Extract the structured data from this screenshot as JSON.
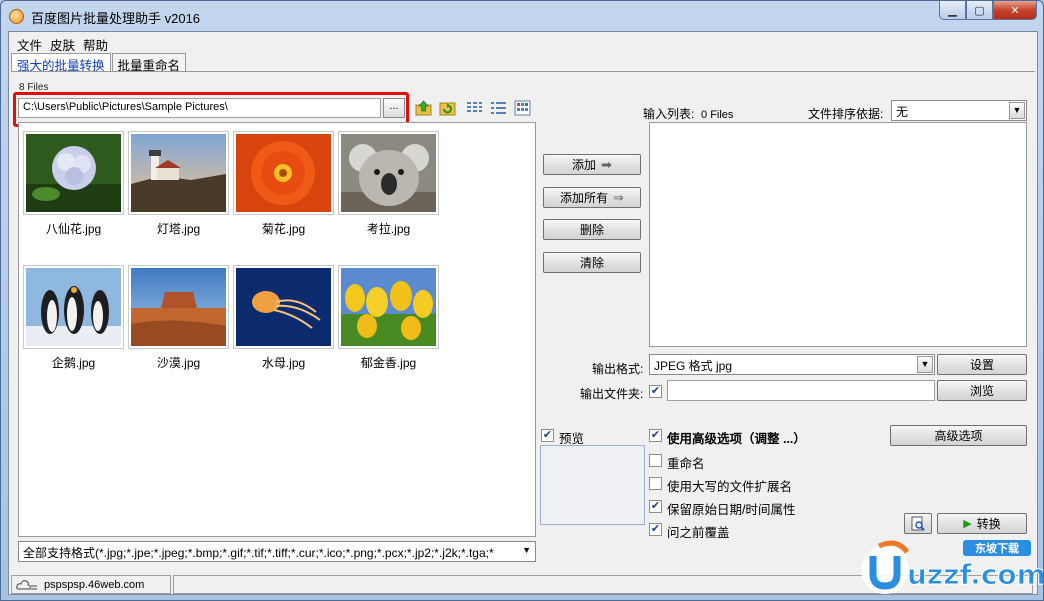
{
  "window": {
    "title": "百度图片批量处理助手  v2016",
    "minimize_icon": "minimize-icon",
    "maximize_icon": "maximize-icon",
    "close_icon": "close-icon"
  },
  "menu": [
    "文件",
    "皮肤",
    "帮助"
  ],
  "tabs": [
    {
      "label": "强大的批量转换",
      "active": true
    },
    {
      "label": "批量重命名",
      "active": false
    }
  ],
  "left": {
    "file_count": "8 Files",
    "path": "C:\\Users\\Public\\Pictures\\Sample Pictures\\",
    "browse_label": "...",
    "toolbar_icons": [
      "folder-up-icon",
      "refresh-icon",
      "list-view-icon",
      "detail-view-icon",
      "thumbnail-view-icon"
    ],
    "thumbnails": [
      {
        "name": "八仙花.jpg",
        "icon": "hydrangea-photo"
      },
      {
        "name": "灯塔.jpg",
        "icon": "lighthouse-photo"
      },
      {
        "name": "菊花.jpg",
        "icon": "chrysanthemum-photo"
      },
      {
        "name": "考拉.jpg",
        "icon": "koala-photo"
      },
      {
        "name": "企鹅.jpg",
        "icon": "penguins-photo"
      },
      {
        "name": "沙漠.jpg",
        "icon": "desert-photo"
      },
      {
        "name": "水母.jpg",
        "icon": "jellyfish-photo"
      },
      {
        "name": "郁金香.jpg",
        "icon": "tulips-photo"
      }
    ],
    "filter": "全部支持格式(*.jpg;*.jpe;*.jpeg;*.bmp;*.gif;*.tif;*.tiff;*.cur;*.ico;*.png;*.pcx;*.jp2;*.j2k;*.tga;*"
  },
  "middle": {
    "add": "添加",
    "add_all": "添加所有",
    "delete": "删除",
    "clear": "清除"
  },
  "right": {
    "input_list_label": "输入列表:",
    "input_list_count": "0 Files",
    "sort_label": "文件排序依据:",
    "sort_value": "无",
    "output_format_label": "输出格式:",
    "output_format_value": "JPEG 格式 jpg",
    "settings": "设置",
    "output_folder_label": "输出文件夹:",
    "output_folder_checked": true,
    "output_folder_value": "",
    "browse": "浏览",
    "preview_label": "预览",
    "preview_checked": true,
    "options": [
      {
        "label": "使用高级选项（调整 ...）",
        "checked": true,
        "bold": true
      },
      {
        "label": "重命名",
        "checked": false
      },
      {
        "label": "使用大写的文件扩展名",
        "checked": false
      },
      {
        "label": "保留原始日期/时间属性",
        "checked": true
      },
      {
        "label": "问之前覆盖",
        "checked": true
      }
    ],
    "advanced": "高级选项",
    "convert": "转换"
  },
  "status": {
    "site": "pspspsp.46web.com"
  },
  "watermark": {
    "cn": "东坡下载",
    "en": "uzzf.com"
  }
}
